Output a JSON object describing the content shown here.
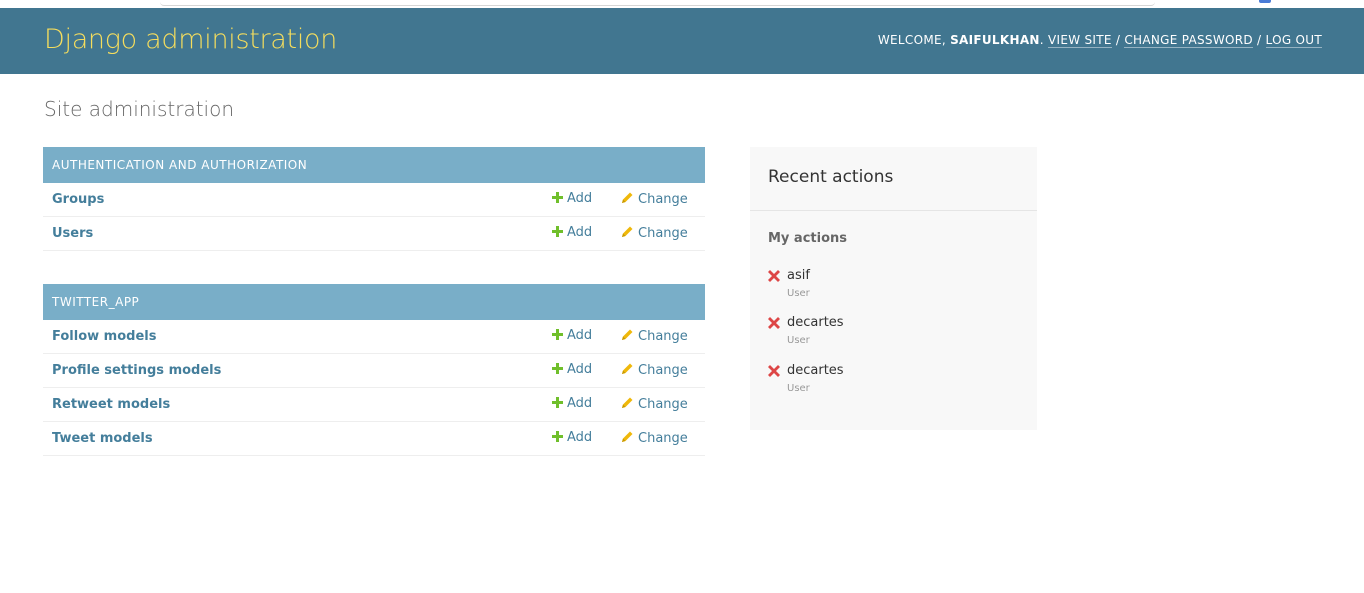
{
  "header": {
    "site_name": "Django administration",
    "welcome_prefix": "WELCOME, ",
    "username": "SAIFULKHAN",
    "welcome_suffix": ". ",
    "links": [
      "VIEW SITE",
      "CHANGE PASSWORD",
      "LOG OUT"
    ],
    "separator": " / "
  },
  "page_title": "Site administration",
  "modules": [
    {
      "caption": "AUTHENTICATION AND AUTHORIZATION",
      "models": [
        "Groups",
        "Users"
      ]
    },
    {
      "caption": "TWITTER_APP",
      "models": [
        "Follow models",
        "Profile settings models",
        "Retweet models",
        "Tweet models"
      ]
    }
  ],
  "row_actions": {
    "add_label": "Add",
    "change_label": "Change",
    "add_icon": "plus-icon",
    "change_icon": "pencil-icon"
  },
  "recent_actions": {
    "title": "Recent actions",
    "subtitle": "My actions",
    "items": [
      {
        "name": "asif",
        "type": "User",
        "icon": "deletion-icon"
      },
      {
        "name": "decartes",
        "type": "User",
        "icon": "deletion-icon"
      },
      {
        "name": "decartes",
        "type": "User",
        "icon": "deletion-icon"
      }
    ]
  },
  "colors": {
    "header_bg": "#417690",
    "site_name": "#f5dd5d",
    "module_caption_bg": "#79aec8",
    "link": "#447e9b",
    "add_icon": "#70bf2b",
    "change_icon": "#efb80b",
    "delete_icon": "#dd4646"
  }
}
